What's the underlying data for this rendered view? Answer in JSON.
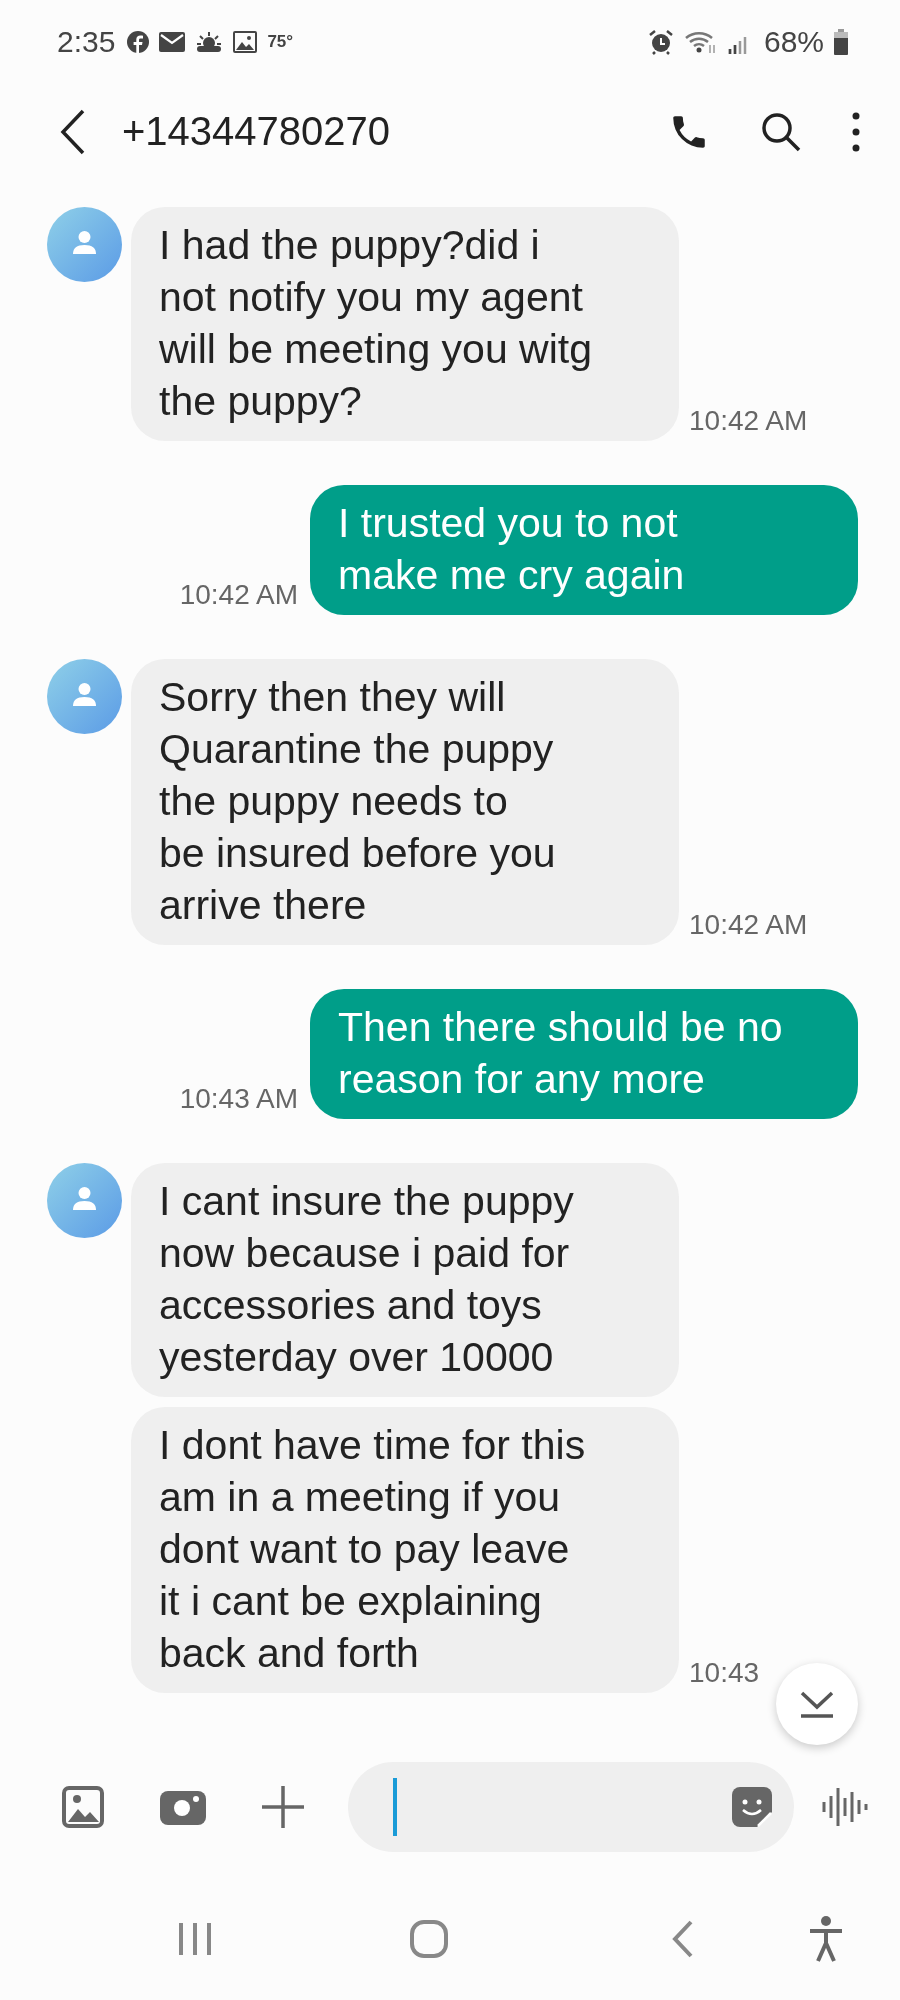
{
  "status_bar": {
    "time": "2:35",
    "temperature": "75°",
    "battery": "68%"
  },
  "header": {
    "contact": "+14344780270"
  },
  "messages": [
    {
      "kind": "incoming",
      "show_avatar": true,
      "text": "I had the puppy?did i\nnot notify you my agent\nwill be meeting you witg\nthe puppy?",
      "time": "10:42 AM"
    },
    {
      "kind": "outgoing",
      "text": "I trusted you to not\nmake me cry again",
      "time": "10:42 AM"
    },
    {
      "kind": "incoming",
      "show_avatar": true,
      "text": "Sorry then they will\nQuarantine the puppy\nthe puppy needs to\nbe insured before you\narrive there",
      "time": "10:42 AM"
    },
    {
      "kind": "outgoing",
      "text": "Then there should be no\nreason for any more",
      "time": "10:43 AM"
    },
    {
      "kind": "incoming",
      "show_avatar": true,
      "text": "I cant insure the puppy\nnow because i paid for\naccessories and toys\nyesterday over 10000"
    },
    {
      "kind": "incoming",
      "show_avatar": false,
      "text": "I dont have time for this\nam in a meeting if you\ndont want to pay leave\nit i cant be explaining\nback and forth",
      "time": "10:43"
    }
  ]
}
